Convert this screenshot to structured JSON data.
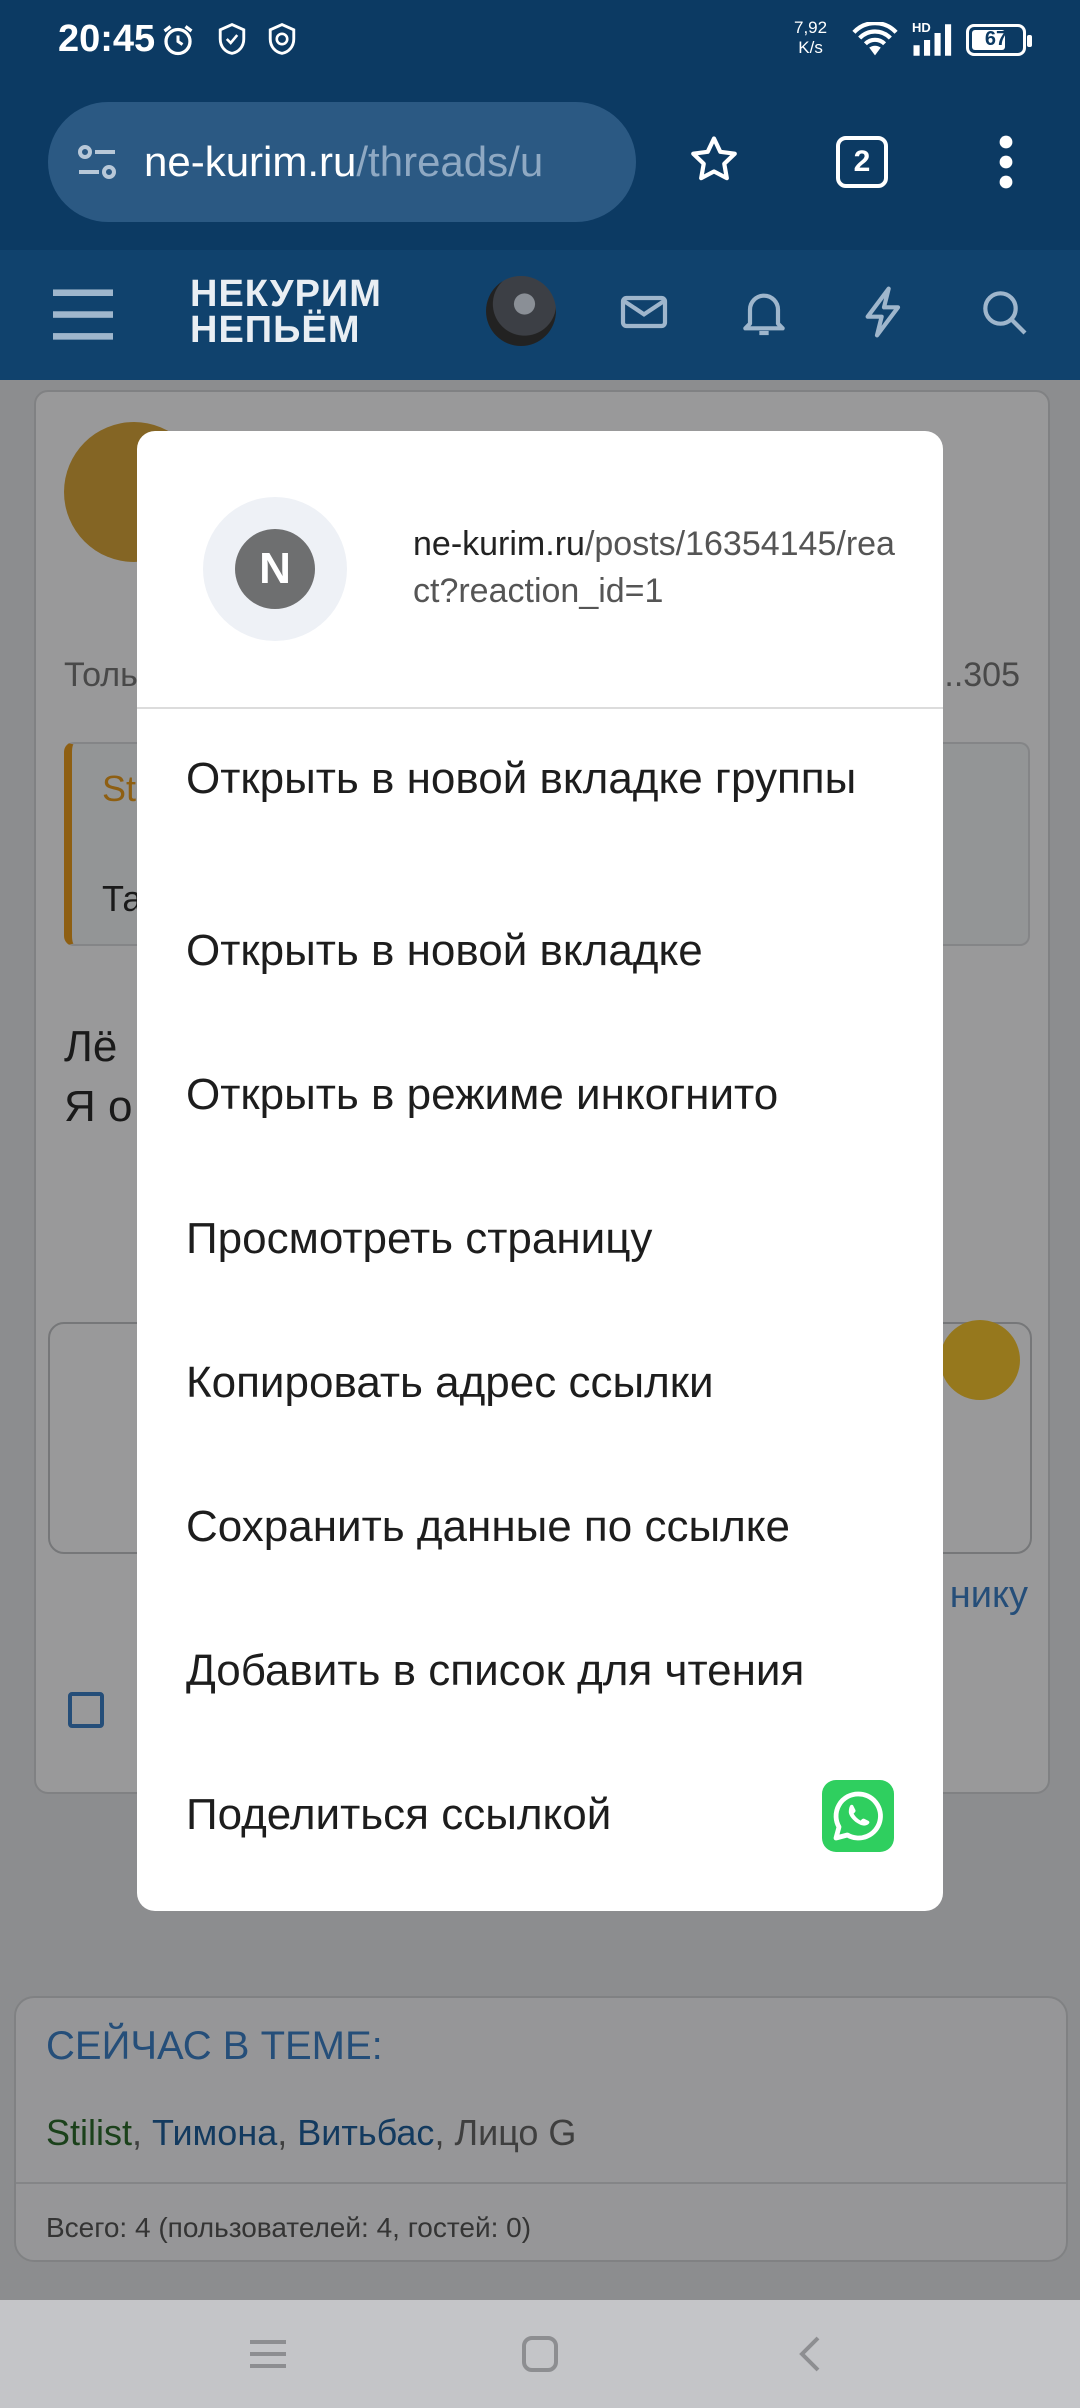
{
  "status_bar": {
    "time": "20:45",
    "net_speed_value": "7,92",
    "net_speed_unit": "K/s",
    "network_type": "HD",
    "battery": "67",
    "icons": [
      "alarm-icon",
      "shield-icon",
      "shield-clock-icon",
      "wifi-icon",
      "signal-icon",
      "battery-icon"
    ]
  },
  "browser": {
    "url_host": "ne-kurim.ru",
    "url_path": "/threads/u",
    "tab_count": "2"
  },
  "site_header": {
    "logo_line1": "НЕКУРИМ",
    "logo_line2": "НЕПЬЁМ"
  },
  "background_page": {
    "text_only": "Толь",
    "text_count": "..305",
    "quote_author": "St",
    "quote_text": "Та",
    "post_line1": "Лё",
    "post_line2": "Я о",
    "link_fragment": "нику",
    "now_in_topic": {
      "title": "СЕЙЧАС В ТЕМЕ:",
      "user1": "Stilist",
      "user2": "Тимона",
      "user3": "Витьбас",
      "user4": "Лицо G",
      "total": "Всего: 4 (пользователей: 4, гостей: 0)"
    }
  },
  "context_menu": {
    "favicon_letter": "N",
    "link_host": "ne-kurim.ru",
    "link_rest": "/posts/16354145/react?reaction_id=1",
    "items": [
      "Открыть в новой вкладке группы",
      "Открыть в новой вкладке",
      "Открыть в режиме инкогнито",
      "Просмотреть страницу",
      "Копировать адрес ссылки",
      "Сохранить данные по ссылке",
      "Добавить в список для чтения",
      "Поделиться ссылкой"
    ],
    "share_app_icon": "whatsapp-icon"
  },
  "colors": {
    "toolbar": "#0c3a63",
    "site_header": "#10426d",
    "accent_blue": "#3d7fc4",
    "whatsapp_green": "#2fcf5f"
  }
}
